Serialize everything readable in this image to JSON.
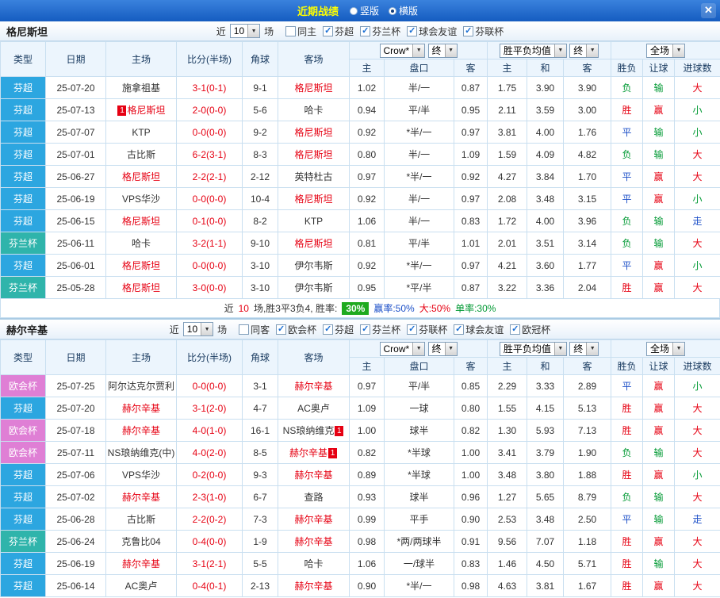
{
  "topbar": {
    "title": "近期战绩",
    "layout_options": [
      {
        "label": "竖版",
        "selected": false
      },
      {
        "label": "横版",
        "selected": true
      }
    ],
    "close_label": "✕"
  },
  "table_head": {
    "type": "类型",
    "date": "日期",
    "home": "主场",
    "score": "比分(半场)",
    "corner": "角球",
    "away": "客场",
    "odds_company": "Crow*",
    "final": "终",
    "mean_label": "胜平负均值",
    "scope": "全场",
    "sub": [
      "主",
      "盘口",
      "客",
      "主",
      "和",
      "客",
      "胜负",
      "让球",
      "进球数"
    ]
  },
  "colors": {
    "league_super": "#2ca6e0",
    "league_cup": "#2fb4ab",
    "league_conference": "#df7fd5",
    "win": "#e60012",
    "lose": "#009933",
    "draw": "#1d50c8",
    "rate_box": "#1faa1f"
  },
  "sections": [
    {
      "team": "格尼斯坦",
      "near_label": "近",
      "near_count": "10",
      "games_label": "场",
      "filters": [
        {
          "label": "同主",
          "checked": false
        },
        {
          "label": "芬超",
          "checked": true
        },
        {
          "label": "芬兰杯",
          "checked": true
        },
        {
          "label": "球会友谊",
          "checked": true
        },
        {
          "label": "芬联杯",
          "checked": true
        }
      ],
      "rows": [
        {
          "league": "芬超",
          "date": "25-07-20",
          "home": "施拿祖基",
          "home_focus": false,
          "home_badge": "",
          "home_badge_pos": "",
          "score": "3-1(0-1)",
          "corners": "9-1",
          "away": "格尼斯坦",
          "away_focus": true,
          "away_badge": "",
          "away_badge_pos": "",
          "o1": "1.02",
          "hcp": "半/一",
          "o2": "0.87",
          "m1": "1.75",
          "m2": "3.90",
          "m3": "3.90",
          "r1": "负",
          "r2": "输",
          "r3": "大"
        },
        {
          "league": "芬超",
          "date": "25-07-13",
          "home": "格尼斯坦",
          "home_focus": true,
          "home_badge": "1",
          "home_badge_pos": "before",
          "score": "2-0(0-0)",
          "corners": "5-6",
          "away": "哈卡",
          "away_focus": false,
          "away_badge": "",
          "away_badge_pos": "",
          "o1": "0.94",
          "hcp": "平/半",
          "o2": "0.95",
          "m1": "2.11",
          "m2": "3.59",
          "m3": "3.00",
          "r1": "胜",
          "r2": "赢",
          "r3": "小"
        },
        {
          "league": "芬超",
          "date": "25-07-07",
          "home": "KTP",
          "home_focus": false,
          "home_badge": "",
          "home_badge_pos": "",
          "score": "0-0(0-0)",
          "corners": "9-2",
          "away": "格尼斯坦",
          "away_focus": true,
          "away_badge": "",
          "away_badge_pos": "",
          "o1": "0.92",
          "hcp": "*半/一",
          "o2": "0.97",
          "m1": "3.81",
          "m2": "4.00",
          "m3": "1.76",
          "r1": "平",
          "r2": "输",
          "r3": "小"
        },
        {
          "league": "芬超",
          "date": "25-07-01",
          "home": "古比斯",
          "home_focus": false,
          "home_badge": "",
          "home_badge_pos": "",
          "score": "6-2(3-1)",
          "corners": "8-3",
          "away": "格尼斯坦",
          "away_focus": true,
          "away_badge": "",
          "away_badge_pos": "",
          "o1": "0.80",
          "hcp": "半/一",
          "o2": "1.09",
          "m1": "1.59",
          "m2": "4.09",
          "m3": "4.82",
          "r1": "负",
          "r2": "输",
          "r3": "大"
        },
        {
          "league": "芬超",
          "date": "25-06-27",
          "home": "格尼斯坦",
          "home_focus": true,
          "home_badge": "",
          "home_badge_pos": "",
          "score": "2-2(2-1)",
          "corners": "2-12",
          "away": "英特杜古",
          "away_focus": false,
          "away_badge": "",
          "away_badge_pos": "",
          "o1": "0.97",
          "hcp": "*半/一",
          "o2": "0.92",
          "m1": "4.27",
          "m2": "3.84",
          "m3": "1.70",
          "r1": "平",
          "r2": "赢",
          "r3": "大"
        },
        {
          "league": "芬超",
          "date": "25-06-19",
          "home": "VPS华沙",
          "home_focus": false,
          "home_badge": "",
          "home_badge_pos": "",
          "score": "0-0(0-0)",
          "corners": "10-4",
          "away": "格尼斯坦",
          "away_focus": true,
          "away_badge": "",
          "away_badge_pos": "",
          "o1": "0.92",
          "hcp": "半/一",
          "o2": "0.97",
          "m1": "2.08",
          "m2": "3.48",
          "m3": "3.15",
          "r1": "平",
          "r2": "赢",
          "r3": "小"
        },
        {
          "league": "芬超",
          "date": "25-06-15",
          "home": "格尼斯坦",
          "home_focus": true,
          "home_badge": "",
          "home_badge_pos": "",
          "score": "0-1(0-0)",
          "corners": "8-2",
          "away": "KTP",
          "away_focus": false,
          "away_badge": "",
          "away_badge_pos": "",
          "o1": "1.06",
          "hcp": "半/一",
          "o2": "0.83",
          "m1": "1.72",
          "m2": "4.00",
          "m3": "3.96",
          "r1": "负",
          "r2": "输",
          "r3": "走"
        },
        {
          "league": "芬兰杯",
          "date": "25-06-11",
          "home": "哈卡",
          "home_focus": false,
          "home_badge": "",
          "home_badge_pos": "",
          "score": "3-2(1-1)",
          "corners": "9-10",
          "away": "格尼斯坦",
          "away_focus": true,
          "away_badge": "",
          "away_badge_pos": "",
          "o1": "0.81",
          "hcp": "平/半",
          "o2": "1.01",
          "m1": "2.01",
          "m2": "3.51",
          "m3": "3.14",
          "r1": "负",
          "r2": "输",
          "r3": "大"
        },
        {
          "league": "芬超",
          "date": "25-06-01",
          "home": "格尼斯坦",
          "home_focus": true,
          "home_badge": "",
          "home_badge_pos": "",
          "score": "0-0(0-0)",
          "corners": "3-10",
          "away": "伊尔韦斯",
          "away_focus": false,
          "away_badge": "",
          "away_badge_pos": "",
          "o1": "0.92",
          "hcp": "*半/一",
          "o2": "0.97",
          "m1": "4.21",
          "m2": "3.60",
          "m3": "1.77",
          "r1": "平",
          "r2": "赢",
          "r3": "小"
        },
        {
          "league": "芬兰杯",
          "date": "25-05-28",
          "home": "格尼斯坦",
          "home_focus": true,
          "home_badge": "",
          "home_badge_pos": "",
          "score": "3-0(0-0)",
          "corners": "3-10",
          "away": "伊尔韦斯",
          "away_focus": false,
          "away_badge": "",
          "away_badge_pos": "",
          "o1": "0.95",
          "hcp": "*平/半",
          "o2": "0.87",
          "m1": "3.22",
          "m2": "3.36",
          "m3": "2.04",
          "r1": "胜",
          "r2": "赢",
          "r3": "大"
        }
      ],
      "summary": {
        "near": "近",
        "count": "10",
        "record": "场,胜3平3负4, 胜率:",
        "win_rate_box": "30%",
        "odds_win_rate": "赢率:50%",
        "big_rate": "大:50%",
        "single_rate": "单率:30%"
      }
    },
    {
      "team": "赫尔辛基",
      "near_label": "近",
      "near_count": "10",
      "games_label": "场",
      "filters": [
        {
          "label": "同客",
          "checked": false
        },
        {
          "label": "欧会杯",
          "checked": true
        },
        {
          "label": "芬超",
          "checked": true
        },
        {
          "label": "芬兰杯",
          "checked": true
        },
        {
          "label": "芬联杯",
          "checked": true
        },
        {
          "label": "球会友谊",
          "checked": true
        },
        {
          "label": "欧冠杯",
          "checked": true
        }
      ],
      "rows": [
        {
          "league": "欧会杯",
          "date": "25-07-25",
          "home": "阿尔达克尔贾利",
          "home_focus": false,
          "home_badge": "",
          "home_badge_pos": "",
          "score": "0-0(0-0)",
          "corners": "3-1",
          "away": "赫尔辛基",
          "away_focus": true,
          "away_badge": "",
          "away_badge_pos": "",
          "o1": "0.97",
          "hcp": "平/半",
          "o2": "0.85",
          "m1": "2.29",
          "m2": "3.33",
          "m3": "2.89",
          "r1": "平",
          "r2": "赢",
          "r3": "小"
        },
        {
          "league": "芬超",
          "date": "25-07-20",
          "home": "赫尔辛基",
          "home_focus": true,
          "home_badge": "",
          "home_badge_pos": "",
          "score": "3-1(2-0)",
          "corners": "4-7",
          "away": "AC奥卢",
          "away_focus": false,
          "away_badge": "",
          "away_badge_pos": "",
          "o1": "1.09",
          "hcp": "一球",
          "o2": "0.80",
          "m1": "1.55",
          "m2": "4.15",
          "m3": "5.13",
          "r1": "胜",
          "r2": "赢",
          "r3": "大"
        },
        {
          "league": "欧会杯",
          "date": "25-07-18",
          "home": "赫尔辛基",
          "home_focus": true,
          "home_badge": "",
          "home_badge_pos": "",
          "score": "4-0(1-0)",
          "corners": "16-1",
          "away": "NS琅纳维克",
          "away_focus": false,
          "away_badge": "1",
          "away_badge_pos": "after",
          "o1": "1.00",
          "hcp": "球半",
          "o2": "0.82",
          "m1": "1.30",
          "m2": "5.93",
          "m3": "7.13",
          "r1": "胜",
          "r2": "赢",
          "r3": "大"
        },
        {
          "league": "欧会杯",
          "date": "25-07-11",
          "home": "NS琅纳维克(中)",
          "home_focus": false,
          "home_badge": "",
          "home_badge_pos": "",
          "score": "4-0(2-0)",
          "corners": "8-5",
          "away": "赫尔辛基",
          "away_focus": true,
          "away_badge": "1",
          "away_badge_pos": "after",
          "o1": "0.82",
          "hcp": "*半球",
          "o2": "1.00",
          "m1": "3.41",
          "m2": "3.79",
          "m3": "1.90",
          "r1": "负",
          "r2": "输",
          "r3": "大"
        },
        {
          "league": "芬超",
          "date": "25-07-06",
          "home": "VPS华沙",
          "home_focus": false,
          "home_badge": "",
          "home_badge_pos": "",
          "score": "0-2(0-0)",
          "corners": "9-3",
          "away": "赫尔辛基",
          "away_focus": true,
          "away_badge": "",
          "away_badge_pos": "",
          "o1": "0.89",
          "hcp": "*半球",
          "o2": "1.00",
          "m1": "3.48",
          "m2": "3.80",
          "m3": "1.88",
          "r1": "胜",
          "r2": "赢",
          "r3": "小"
        },
        {
          "league": "芬超",
          "date": "25-07-02",
          "home": "赫尔辛基",
          "home_focus": true,
          "home_badge": "",
          "home_badge_pos": "",
          "score": "2-3(1-0)",
          "corners": "6-7",
          "away": "查路",
          "away_focus": false,
          "away_badge": "",
          "away_badge_pos": "",
          "o1": "0.93",
          "hcp": "球半",
          "o2": "0.96",
          "m1": "1.27",
          "m2": "5.65",
          "m3": "8.79",
          "r1": "负",
          "r2": "输",
          "r3": "大"
        },
        {
          "league": "芬超",
          "date": "25-06-28",
          "home": "古比斯",
          "home_focus": false,
          "home_badge": "",
          "home_badge_pos": "",
          "score": "2-2(0-2)",
          "corners": "7-3",
          "away": "赫尔辛基",
          "away_focus": true,
          "away_badge": "",
          "away_badge_pos": "",
          "o1": "0.99",
          "hcp": "平手",
          "o2": "0.90",
          "m1": "2.53",
          "m2": "3.48",
          "m3": "2.50",
          "r1": "平",
          "r2": "输",
          "r3": "走"
        },
        {
          "league": "芬兰杯",
          "date": "25-06-24",
          "home": "克鲁比04",
          "home_focus": false,
          "home_badge": "",
          "home_badge_pos": "",
          "score": "0-4(0-0)",
          "corners": "1-9",
          "away": "赫尔辛基",
          "away_focus": true,
          "away_badge": "",
          "away_badge_pos": "",
          "o1": "0.98",
          "hcp": "*两/两球半",
          "o2": "0.91",
          "m1": "9.56",
          "m2": "7.07",
          "m3": "1.18",
          "r1": "胜",
          "r2": "赢",
          "r3": "大"
        },
        {
          "league": "芬超",
          "date": "25-06-19",
          "home": "赫尔辛基",
          "home_focus": true,
          "home_badge": "",
          "home_badge_pos": "",
          "score": "3-1(2-1)",
          "corners": "5-5",
          "away": "哈卡",
          "away_focus": false,
          "away_badge": "",
          "away_badge_pos": "",
          "o1": "1.06",
          "hcp": "一/球半",
          "o2": "0.83",
          "m1": "1.46",
          "m2": "4.50",
          "m3": "5.71",
          "r1": "胜",
          "r2": "输",
          "r3": "大"
        },
        {
          "league": "芬超",
          "date": "25-06-14",
          "home": "AC奥卢",
          "home_focus": false,
          "home_badge": "",
          "home_badge_pos": "",
          "score": "0-4(0-1)",
          "corners": "2-13",
          "away": "赫尔辛基",
          "away_focus": true,
          "away_badge": "",
          "away_badge_pos": "",
          "o1": "0.90",
          "hcp": "*半/一",
          "o2": "0.98",
          "m1": "4.63",
          "m2": "3.81",
          "m3": "1.67",
          "r1": "胜",
          "r2": "赢",
          "r3": "大"
        }
      ],
      "summary": null
    }
  ]
}
